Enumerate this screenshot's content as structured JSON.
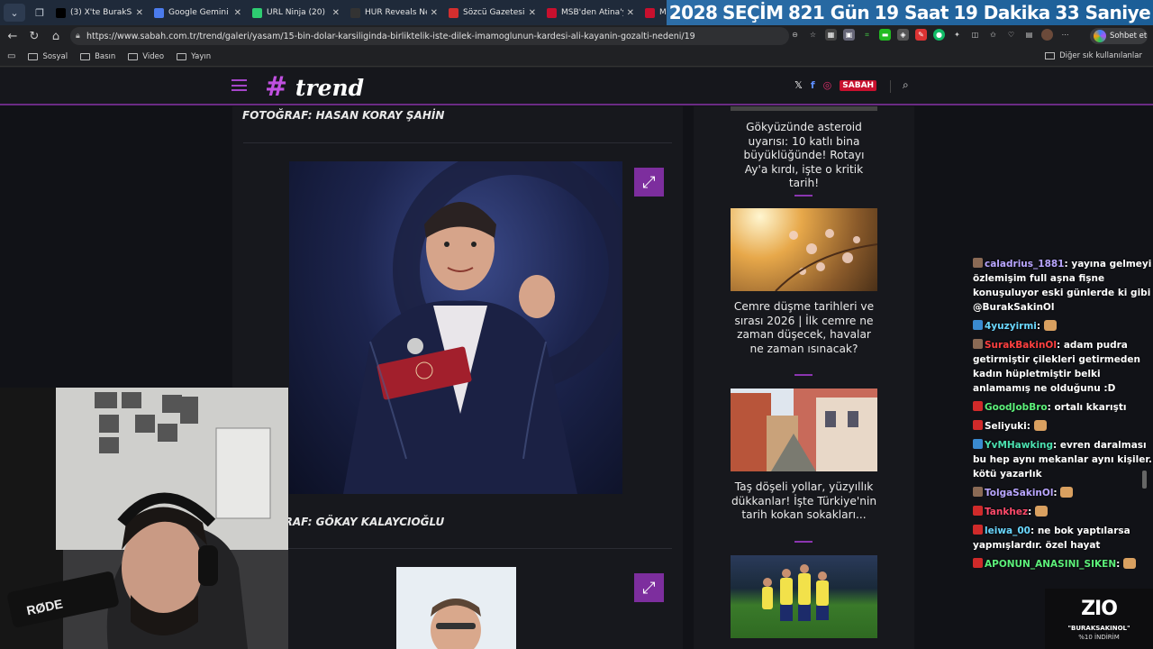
{
  "tabs": [
    {
      "title": "(3) X'te BurakSakinOl",
      "favicon": "x-icon",
      "color": "#000000"
    },
    {
      "title": "Google Gemini",
      "favicon": "gemini-icon",
      "color": "#4b7bec"
    },
    {
      "title": "URL Ninja (20)",
      "favicon": "ninja-icon",
      "color": "#2ecc71"
    },
    {
      "title": "HUR Reveals New R",
      "favicon": "hur-icon",
      "color": "#333333"
    },
    {
      "title": "Sözcü Gazetesi - Ha",
      "favicon": "sozcu-icon",
      "color": "#d32f2f"
    },
    {
      "title": "MSB'den Atina'ya 1",
      "favicon": "msb-icon",
      "color": "#c8102e"
    },
    {
      "title": "MHP",
      "favicon": "mhp-icon",
      "color": "#c8102e"
    }
  ],
  "countdown": {
    "year": "2028",
    "label": "SEÇİM",
    "days": "821 Gün",
    "hours": "19 Saat",
    "minutes": "19 Dakika",
    "seconds": "33 Saniye"
  },
  "url": "https://www.sabah.com.tr/trend/galeri/yasam/15-bin-dolar-karsiliginda-birliktelik-iste-dilek-imamoglunun-kardesi-ali-kayanin-gozalti-nedeni/19",
  "copilot_label": "Sohbet et",
  "bookmarks": [
    "Sosyal",
    "Basın",
    "Video",
    "Yayın"
  ],
  "bookmarks_right": "Diğer sık kullanılanlar",
  "site": {
    "brand": "trend",
    "sabah_logo": "SABAH"
  },
  "captions": {
    "first": "FOTOĞRAF: HASAN KORAY ŞAHİN",
    "second": "FOTOĞRAF: GÖKAY KALAYCIOĞLU"
  },
  "sidebar_cards": [
    {
      "title": "Gökyüzünde asteroid uyarısı: 10 katlı bina büyüklüğünde! Rotayı Ay'a kırdı, işte o kritik tarih!"
    },
    {
      "title": "Cemre düşme tarihleri ve sırası 2026 | İlk cemre ne zaman düşecek, havalar ne zaman ısınacak?"
    },
    {
      "title": "Taş döşeli yollar, yüzyıllık dükkanlar! İşte Türkiye'nin tarih kokan sokakları..."
    }
  ],
  "chat": [
    {
      "user": "caladrius_1881",
      "color": "#b9a6ff",
      "text": "yayına gelmeyi özlemişim full aşna fişne konuşuluyor eski günlerde ki gibi @BurakSakinOl"
    },
    {
      "user": "4yuzyirmi",
      "color": "#6ad7ff",
      "text": ""
    },
    {
      "user": "SurakBakinOl",
      "color": "#ff4040",
      "text": "adam pudra getirmiştir çilekleri getirmeden kadın hüpletmiştir belki anlamamış ne olduğunu :D"
    },
    {
      "user": "GoodJobBro",
      "color": "#5cf07a",
      "text": "ortalı kkarıştı"
    },
    {
      "user": "Seliyuki",
      "color": "#ffffff",
      "text": ""
    },
    {
      "user": "YvMHawking",
      "color": "#4be0b0",
      "text": "evren daralması bu hep aynı mekanlar aynı kişiler. kötü yazarlık"
    },
    {
      "user": "TolgaSakinOl",
      "color": "#b9a6ff",
      "text": ""
    },
    {
      "user": "Tankhez",
      "color": "#ff4a6a",
      "text": ""
    },
    {
      "user": "leiwa_00",
      "color": "#6ad7ff",
      "text": "ne bok yaptılarsa yapmışlardır. özel hayat"
    },
    {
      "user": "APONUN_ANASINI_SIKEN",
      "color": "#5cf07a",
      "text": ""
    }
  ],
  "sponsor": {
    "logo": "ZIO",
    "line1": "\"BURAKSAKINOL\"",
    "line2": "%10 İNDİRİM"
  }
}
